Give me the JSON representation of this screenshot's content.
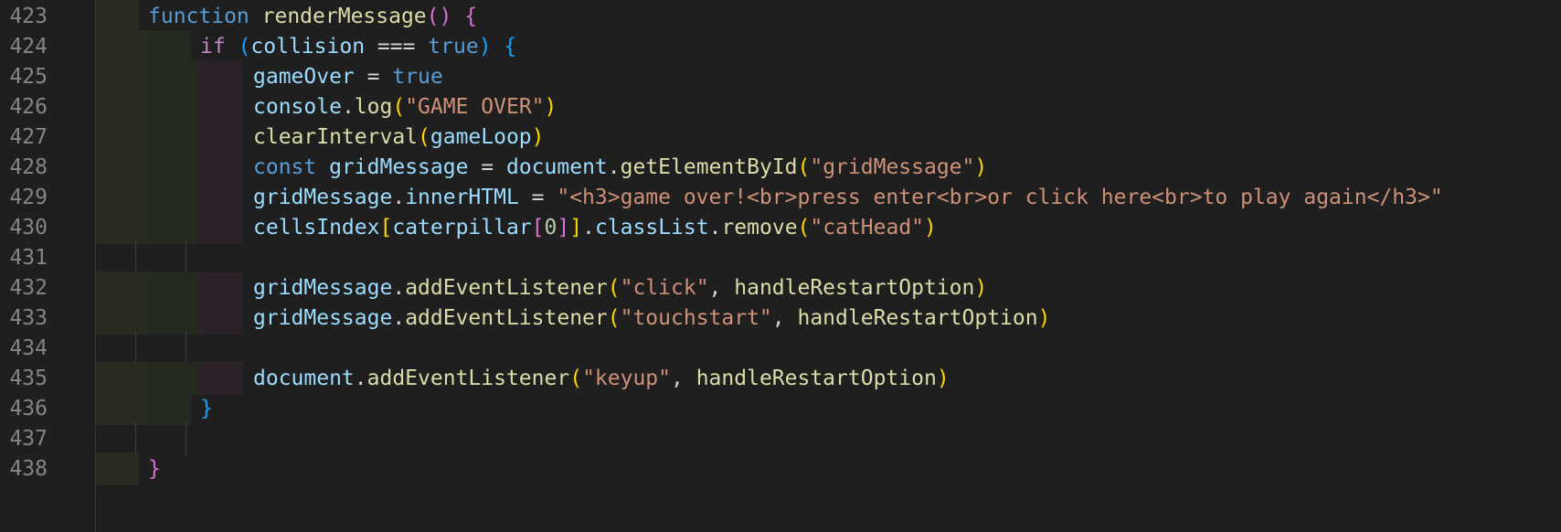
{
  "editor": {
    "colors": {
      "background": "#1f1f1f",
      "line_number": "#858585",
      "keyword": "#569cd6",
      "control": "#c586c0",
      "function": "#dcdcaa",
      "variable": "#9cdcfe",
      "string": "#ce9178",
      "number": "#b5cea8",
      "plain": "#d4d4d4",
      "bracket_gold": "#ffd700",
      "bracket_pink": "#da70d6",
      "bracket_blue": "#179fff"
    },
    "lines": [
      {
        "num": "423",
        "indent": 0,
        "tokens": [
          {
            "t": "function",
            "c": "keyword"
          },
          {
            "t": " ",
            "c": "plain"
          },
          {
            "t": "renderMessage",
            "c": "function"
          },
          {
            "t": "()",
            "c": "bracket_pink"
          },
          {
            "t": " ",
            "c": "plain"
          },
          {
            "t": "{",
            "c": "bracket_pink"
          }
        ]
      },
      {
        "num": "424",
        "indent": 1,
        "tokens": [
          {
            "t": "if",
            "c": "control"
          },
          {
            "t": " ",
            "c": "plain"
          },
          {
            "t": "(",
            "c": "bracket_blue"
          },
          {
            "t": "collision",
            "c": "variable"
          },
          {
            "t": " === ",
            "c": "plain"
          },
          {
            "t": "true",
            "c": "keyword"
          },
          {
            "t": ")",
            "c": "bracket_blue"
          },
          {
            "t": " ",
            "c": "plain"
          },
          {
            "t": "{",
            "c": "bracket_blue"
          }
        ]
      },
      {
        "num": "425",
        "indent": 2,
        "tokens": [
          {
            "t": "gameOver",
            "c": "variable"
          },
          {
            "t": " = ",
            "c": "plain"
          },
          {
            "t": "true",
            "c": "keyword"
          }
        ]
      },
      {
        "num": "426",
        "indent": 2,
        "tokens": [
          {
            "t": "console",
            "c": "variable"
          },
          {
            "t": ".",
            "c": "plain"
          },
          {
            "t": "log",
            "c": "function"
          },
          {
            "t": "(",
            "c": "bracket_gold"
          },
          {
            "t": "\"GAME OVER\"",
            "c": "string"
          },
          {
            "t": ")",
            "c": "bracket_gold"
          }
        ]
      },
      {
        "num": "427",
        "indent": 2,
        "tokens": [
          {
            "t": "clearInterval",
            "c": "function"
          },
          {
            "t": "(",
            "c": "bracket_gold"
          },
          {
            "t": "gameLoop",
            "c": "variable"
          },
          {
            "t": ")",
            "c": "bracket_gold"
          }
        ]
      },
      {
        "num": "428",
        "indent": 2,
        "tokens": [
          {
            "t": "const",
            "c": "keyword"
          },
          {
            "t": " ",
            "c": "plain"
          },
          {
            "t": "gridMessage",
            "c": "variable"
          },
          {
            "t": " = ",
            "c": "plain"
          },
          {
            "t": "document",
            "c": "variable"
          },
          {
            "t": ".",
            "c": "plain"
          },
          {
            "t": "getElementById",
            "c": "function"
          },
          {
            "t": "(",
            "c": "bracket_gold"
          },
          {
            "t": "\"gridMessage\"",
            "c": "string"
          },
          {
            "t": ")",
            "c": "bracket_gold"
          }
        ]
      },
      {
        "num": "429",
        "indent": 2,
        "tokens": [
          {
            "t": "gridMessage",
            "c": "variable"
          },
          {
            "t": ".",
            "c": "plain"
          },
          {
            "t": "innerHTML",
            "c": "variable"
          },
          {
            "t": " = ",
            "c": "plain"
          },
          {
            "t": "\"<h3>game over!<br>press enter<br>or click here<br>to play again</h3>\"",
            "c": "string"
          }
        ]
      },
      {
        "num": "430",
        "indent": 2,
        "tokens": [
          {
            "t": "cellsIndex",
            "c": "variable"
          },
          {
            "t": "[",
            "c": "bracket_gold"
          },
          {
            "t": "caterpillar",
            "c": "variable"
          },
          {
            "t": "[",
            "c": "bracket_pink"
          },
          {
            "t": "0",
            "c": "number"
          },
          {
            "t": "]",
            "c": "bracket_pink"
          },
          {
            "t": "]",
            "c": "bracket_gold"
          },
          {
            "t": ".",
            "c": "plain"
          },
          {
            "t": "classList",
            "c": "variable"
          },
          {
            "t": ".",
            "c": "plain"
          },
          {
            "t": "remove",
            "c": "function"
          },
          {
            "t": "(",
            "c": "bracket_gold"
          },
          {
            "t": "\"catHead\"",
            "c": "string"
          },
          {
            "t": ")",
            "c": "bracket_gold"
          }
        ]
      },
      {
        "num": "431",
        "indent": -1,
        "tokens": []
      },
      {
        "num": "432",
        "indent": 2,
        "tokens": [
          {
            "t": "gridMessage",
            "c": "variable"
          },
          {
            "t": ".",
            "c": "plain"
          },
          {
            "t": "addEventListener",
            "c": "function"
          },
          {
            "t": "(",
            "c": "bracket_gold"
          },
          {
            "t": "\"click\"",
            "c": "string"
          },
          {
            "t": ", ",
            "c": "plain"
          },
          {
            "t": "handleRestartOption",
            "c": "function"
          },
          {
            "t": ")",
            "c": "bracket_gold"
          }
        ]
      },
      {
        "num": "433",
        "indent": 2,
        "tokens": [
          {
            "t": "gridMessage",
            "c": "variable"
          },
          {
            "t": ".",
            "c": "plain"
          },
          {
            "t": "addEventListener",
            "c": "function"
          },
          {
            "t": "(",
            "c": "bracket_gold"
          },
          {
            "t": "\"touchstart\"",
            "c": "string"
          },
          {
            "t": ", ",
            "c": "plain"
          },
          {
            "t": "handleRestartOption",
            "c": "function"
          },
          {
            "t": ")",
            "c": "bracket_gold"
          }
        ]
      },
      {
        "num": "434",
        "indent": -1,
        "tokens": []
      },
      {
        "num": "435",
        "indent": 2,
        "tokens": [
          {
            "t": "document",
            "c": "variable"
          },
          {
            "t": ".",
            "c": "plain"
          },
          {
            "t": "addEventListener",
            "c": "function"
          },
          {
            "t": "(",
            "c": "bracket_gold"
          },
          {
            "t": "\"keyup\"",
            "c": "string"
          },
          {
            "t": ", ",
            "c": "plain"
          },
          {
            "t": "handleRestartOption",
            "c": "function"
          },
          {
            "t": ")",
            "c": "bracket_gold"
          }
        ]
      },
      {
        "num": "436",
        "indent": 1,
        "tokens": [
          {
            "t": "}",
            "c": "bracket_blue"
          }
        ]
      },
      {
        "num": "437",
        "indent": -1,
        "tokens": []
      },
      {
        "num": "438",
        "indent": 0,
        "tokens": [
          {
            "t": "}",
            "c": "bracket_pink"
          }
        ]
      }
    ]
  }
}
